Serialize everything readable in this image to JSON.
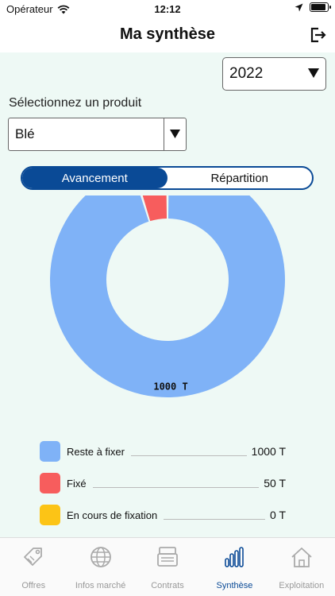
{
  "status_bar": {
    "carrier": "Opérateur",
    "time": "12:12",
    "battery_level": 0.9
  },
  "header": {
    "title": "Ma synthèse",
    "logout_icon": "logout-icon"
  },
  "filters": {
    "year": "2022",
    "product_label": "Sélectionnez un produit",
    "product": "Blé"
  },
  "segment": {
    "tabs": [
      "Avancement",
      "Répartition"
    ],
    "active": 0
  },
  "colors": {
    "accent": "#0a4a96",
    "reste": "#7fb2f7",
    "fixe": "#f75d5d",
    "en_cours": "#fcc416",
    "background": "#eef9f5"
  },
  "chart_data": {
    "type": "pie",
    "subtype": "donut",
    "labels": [
      "Reste à fixer",
      "Fixé",
      "En cours de fixation"
    ],
    "values": [
      1000,
      50,
      0
    ],
    "data_labels": [
      "1000 T",
      "50 T",
      "0 T"
    ],
    "colors": [
      "#7fb2f7",
      "#f75d5d",
      "#fcc416"
    ],
    "legend": "bottom"
  },
  "legend": [
    {
      "label": "Reste à fixer",
      "value": "1000 T",
      "color": "#7fb2f7"
    },
    {
      "label": "Fixé",
      "value": "50 T",
      "color": "#f75d5d"
    },
    {
      "label": "En cours de fixation",
      "value": "0 T",
      "color": "#fcc416"
    }
  ],
  "tabbar": [
    {
      "label": "Offres",
      "icon": "tag-icon"
    },
    {
      "label": "Infos marché",
      "icon": "globe-icon"
    },
    {
      "label": "Contrats",
      "icon": "contracts-icon"
    },
    {
      "label": "Synthèse",
      "icon": "bar-chart-icon",
      "active": true
    },
    {
      "label": "Exploitation",
      "icon": "home-icon"
    }
  ]
}
